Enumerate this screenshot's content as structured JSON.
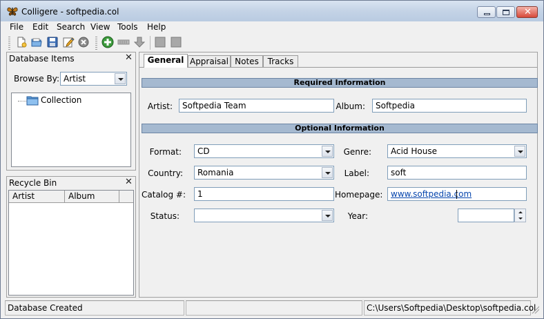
{
  "window": {
    "title": "Colligere - softpedia.col"
  },
  "menu": [
    "File",
    "Edit",
    "Search",
    "View",
    "Tools",
    "Help"
  ],
  "toolbar": {
    "buttons": [
      "new-file-icon",
      "open-folder-icon",
      "save-disk-icon",
      "edit-pencil-icon",
      "close-circle-icon",
      "add-plus-icon",
      "remove-icon",
      "move-down-arrow-icon",
      "view-1-icon",
      "view-2-icon"
    ]
  },
  "database_items": {
    "title": "Database Items",
    "browse_label": "Browse By:",
    "browse_value": "Artist",
    "tree": [
      "Collection"
    ]
  },
  "recycle_bin": {
    "title": "Recycle Bin",
    "columns": [
      "Artist",
      "Album"
    ]
  },
  "tabs": [
    "General",
    "Appraisal",
    "Notes",
    "Tracks"
  ],
  "required": {
    "header": "Required Information",
    "artist_label": "Artist:",
    "artist_value": "Softpedia Team",
    "album_label": "Album:",
    "album_value": "Softpedia"
  },
  "optional": {
    "header": "Optional Information",
    "format_label": "Format:",
    "format_value": "CD",
    "genre_label": "Genre:",
    "genre_value": "Acid House",
    "country_label": "Country:",
    "country_value": "Romania",
    "label_label": "Label:",
    "label_value": "soft",
    "catalog_label": "Catalog #:",
    "catalog_value": "1",
    "homepage_label": "Homepage:",
    "homepage_value": "www.softpedia.com",
    "status_label": "Status:",
    "status_value": "",
    "year_label": "Year:",
    "year_value": ""
  },
  "statusbar": {
    "message": "Database Created",
    "middle": "",
    "path": "C:\\Users\\Softpedia\\Desktop\\softpedia.col"
  },
  "colors": {
    "section_bar": "#a5b9d0",
    "link": "#0645ad"
  }
}
